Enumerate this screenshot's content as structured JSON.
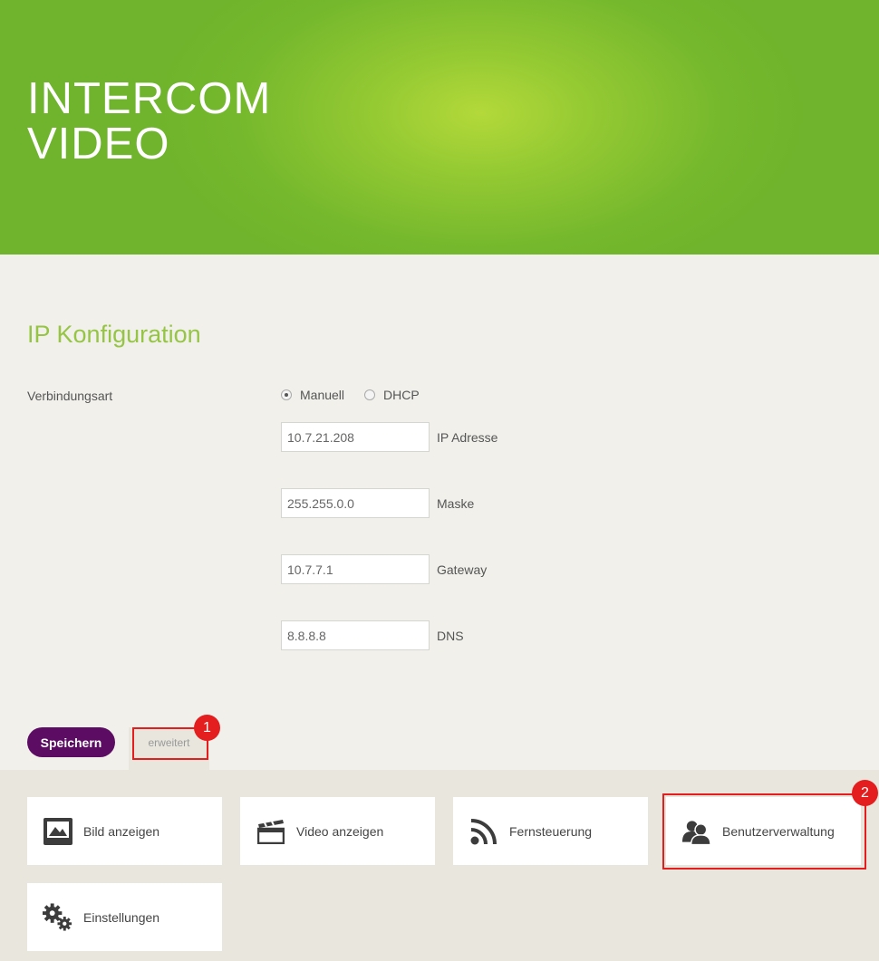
{
  "header": {
    "title_line1": "INTERCOM",
    "title_line2": "VIDEO"
  },
  "config": {
    "section_title": "IP Konfiguration",
    "connection_label": "Verbindungsart",
    "radio_options": [
      {
        "label": "Manuell",
        "checked": true
      },
      {
        "label": "DHCP",
        "checked": false
      }
    ],
    "fields": [
      {
        "value": "10.7.21.208",
        "label": "IP Adresse"
      },
      {
        "value": "255.255.0.0",
        "label": "Maske"
      },
      {
        "value": "10.7.7.1",
        "label": "Gateway"
      },
      {
        "value": "8.8.8.8",
        "label": "DNS"
      }
    ],
    "save_label": "Speichern",
    "advanced_label": "erweitert"
  },
  "annotations": [
    {
      "number": "1"
    },
    {
      "number": "2"
    }
  ],
  "tiles": [
    {
      "label": "Bild anzeigen",
      "icon": "image-icon"
    },
    {
      "label": "Video anzeigen",
      "icon": "video-icon"
    },
    {
      "label": "Fernsteuerung",
      "icon": "rss-icon"
    },
    {
      "label": "Benutzerverwaltung",
      "icon": "users-icon"
    },
    {
      "label": "Einstellungen",
      "icon": "gears-icon"
    }
  ],
  "colors": {
    "header_green": "#7ab92e",
    "accent_green": "#96c546",
    "save_purple": "#5c0d63",
    "annotation_red": "#e41e1e"
  }
}
